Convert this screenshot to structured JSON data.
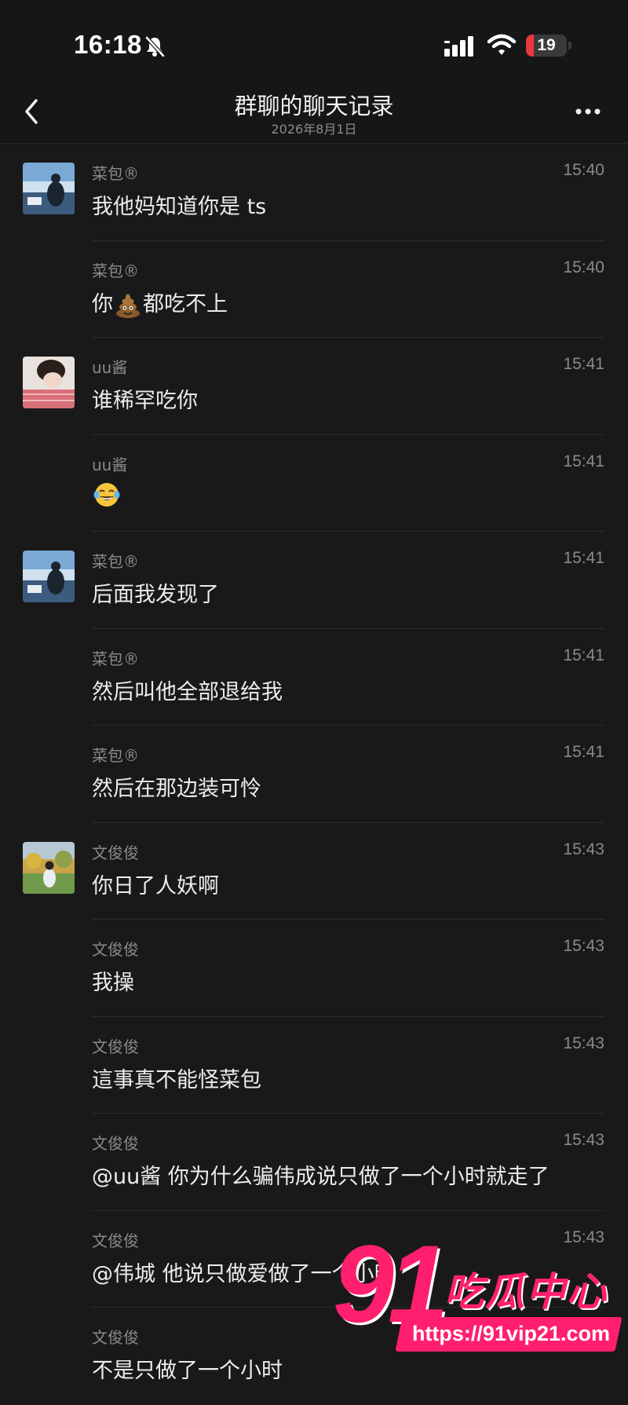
{
  "status_bar": {
    "time": "16:18",
    "battery_level": "19",
    "battery_fraction": 0.19,
    "icons": [
      "bell-slash-icon",
      "signal-icon",
      "wifi-icon",
      "battery-icon"
    ]
  },
  "nav": {
    "title": "群聊的聊天记录",
    "subtitle": "2026年8月1日",
    "icons": [
      "chevron-left-icon",
      "more-horizontal-icon"
    ]
  },
  "messages": [
    {
      "sender": "菜包®",
      "time": "15:40",
      "text": "我他妈知道你是 ts",
      "avatar": "caibao"
    },
    {
      "sender": "菜包®",
      "time": "15:40",
      "text_before": "你",
      "emoji": "pile-of-poo-emoji",
      "text_after": "都吃不上",
      "avatar": ""
    },
    {
      "sender": "uu酱",
      "time": "15:41",
      "text": "谁稀罕吃你",
      "avatar": "uu"
    },
    {
      "sender": "uu酱",
      "time": "15:41",
      "text": "",
      "emoji": "tears-of-joy-emoji",
      "avatar": ""
    },
    {
      "sender": "菜包®",
      "time": "15:41",
      "text": "后面我发现了",
      "avatar": "caibao"
    },
    {
      "sender": "菜包®",
      "time": "15:41",
      "text": "然后叫他全部退给我",
      "avatar": ""
    },
    {
      "sender": "菜包®",
      "time": "15:41",
      "text": "然后在那边装可怜",
      "avatar": ""
    },
    {
      "sender": "文俊俊",
      "time": "15:43",
      "text": "你日了人妖啊",
      "avatar": "wen"
    },
    {
      "sender": "文俊俊",
      "time": "15:43",
      "text": "我操",
      "avatar": ""
    },
    {
      "sender": "文俊俊",
      "time": "15:43",
      "text": "這事真不能怪菜包",
      "avatar": ""
    },
    {
      "sender": "文俊俊",
      "time": "15:43",
      "text": "@uu酱 你为什么骗伟成说只做了一个小时就走了",
      "avatar": ""
    },
    {
      "sender": "文俊俊",
      "time": "15:43",
      "text": "@伟城 他说只做爱做了一个小时",
      "avatar": ""
    },
    {
      "sender": "文俊俊",
      "time": "",
      "text": "不是只做了一个小时",
      "avatar": ""
    }
  ],
  "watermark": {
    "number": "91",
    "brand": "吃瓜中心",
    "url": "https://91vip21.com"
  },
  "colors": {
    "background": "#191919",
    "bar": "#161616",
    "accent": "#ff1f6e",
    "battery_low": "#e8383d"
  }
}
